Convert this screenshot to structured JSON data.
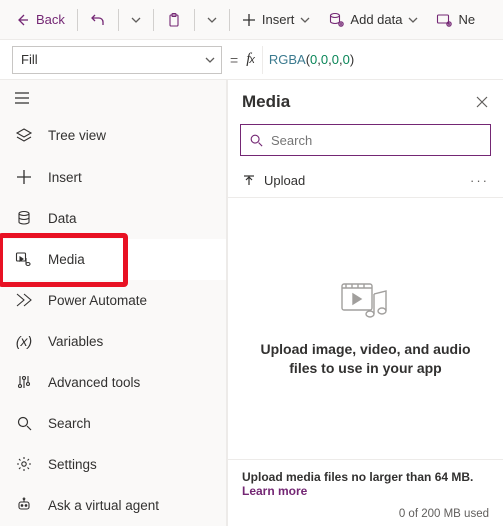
{
  "cmdbar": {
    "back": "Back",
    "insert": "Insert",
    "addData": "Add data",
    "newScreen": "Ne"
  },
  "formula": {
    "property": "Fill",
    "fn": "RGBA",
    "args": [
      "0",
      "0",
      "0",
      "0"
    ]
  },
  "rail": {
    "items": [
      {
        "label": "Tree view"
      },
      {
        "label": "Insert"
      },
      {
        "label": "Data"
      },
      {
        "label": "Media"
      },
      {
        "label": "Power Automate"
      },
      {
        "label": "Variables"
      },
      {
        "label": "Advanced tools"
      },
      {
        "label": "Search"
      },
      {
        "label": "Settings"
      },
      {
        "label": "Ask a virtual agent"
      }
    ]
  },
  "panel": {
    "title": "Media",
    "searchPlaceholder": "Search",
    "upload": "Upload",
    "emptyMsg": "Upload image, video, and audio files to use in your app",
    "footHint": "Upload media files no larger than 64 MB.",
    "learnMore": "Learn more",
    "usage": "0 of 200 MB used"
  }
}
